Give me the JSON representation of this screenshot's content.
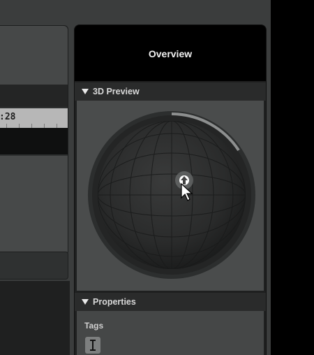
{
  "left_panel": {
    "timecode": ":28"
  },
  "overview": {
    "title": "Overview",
    "sections": {
      "preview": {
        "label": "3D Preview"
      },
      "properties": {
        "label": "Properties",
        "tags_label": "Tags"
      }
    }
  },
  "icons": {
    "collapse": "triangle-down-icon",
    "text_cursor": "text-cursor-icon",
    "pointer": "mouse-pointer-icon",
    "rotate_handle": "rotate-handle-icon"
  },
  "colors": {
    "panel_bg": "#1f2020",
    "title_bar": "#000000",
    "section_header": "#2a2b2b",
    "preview_bg": "#4a4c4c",
    "sphere": "#2b2c2c"
  }
}
